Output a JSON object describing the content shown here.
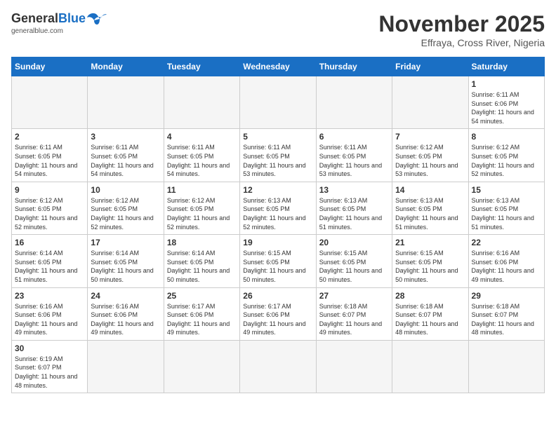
{
  "header": {
    "logo": {
      "general": "General",
      "blue": "Blue",
      "tagline": "generalblue.com"
    },
    "title": "November 2025",
    "subtitle": "Effraya, Cross River, Nigeria"
  },
  "weekdays": [
    "Sunday",
    "Monday",
    "Tuesday",
    "Wednesday",
    "Thursday",
    "Friday",
    "Saturday"
  ],
  "weeks": [
    [
      {
        "day": "",
        "info": ""
      },
      {
        "day": "",
        "info": ""
      },
      {
        "day": "",
        "info": ""
      },
      {
        "day": "",
        "info": ""
      },
      {
        "day": "",
        "info": ""
      },
      {
        "day": "",
        "info": ""
      },
      {
        "day": "1",
        "info": "Sunrise: 6:11 AM\nSunset: 6:06 PM\nDaylight: 11 hours\nand 54 minutes."
      }
    ],
    [
      {
        "day": "2",
        "info": "Sunrise: 6:11 AM\nSunset: 6:05 PM\nDaylight: 11 hours\nand 54 minutes."
      },
      {
        "day": "3",
        "info": "Sunrise: 6:11 AM\nSunset: 6:05 PM\nDaylight: 11 hours\nand 54 minutes."
      },
      {
        "day": "4",
        "info": "Sunrise: 6:11 AM\nSunset: 6:05 PM\nDaylight: 11 hours\nand 54 minutes."
      },
      {
        "day": "5",
        "info": "Sunrise: 6:11 AM\nSunset: 6:05 PM\nDaylight: 11 hours\nand 53 minutes."
      },
      {
        "day": "6",
        "info": "Sunrise: 6:11 AM\nSunset: 6:05 PM\nDaylight: 11 hours\nand 53 minutes."
      },
      {
        "day": "7",
        "info": "Sunrise: 6:12 AM\nSunset: 6:05 PM\nDaylight: 11 hours\nand 53 minutes."
      },
      {
        "day": "8",
        "info": "Sunrise: 6:12 AM\nSunset: 6:05 PM\nDaylight: 11 hours\nand 52 minutes."
      }
    ],
    [
      {
        "day": "9",
        "info": "Sunrise: 6:12 AM\nSunset: 6:05 PM\nDaylight: 11 hours\nand 52 minutes."
      },
      {
        "day": "10",
        "info": "Sunrise: 6:12 AM\nSunset: 6:05 PM\nDaylight: 11 hours\nand 52 minutes."
      },
      {
        "day": "11",
        "info": "Sunrise: 6:12 AM\nSunset: 6:05 PM\nDaylight: 11 hours\nand 52 minutes."
      },
      {
        "day": "12",
        "info": "Sunrise: 6:13 AM\nSunset: 6:05 PM\nDaylight: 11 hours\nand 52 minutes."
      },
      {
        "day": "13",
        "info": "Sunrise: 6:13 AM\nSunset: 6:05 PM\nDaylight: 11 hours\nand 51 minutes."
      },
      {
        "day": "14",
        "info": "Sunrise: 6:13 AM\nSunset: 6:05 PM\nDaylight: 11 hours\nand 51 minutes."
      },
      {
        "day": "15",
        "info": "Sunrise: 6:13 AM\nSunset: 6:05 PM\nDaylight: 11 hours\nand 51 minutes."
      }
    ],
    [
      {
        "day": "16",
        "info": "Sunrise: 6:14 AM\nSunset: 6:05 PM\nDaylight: 11 hours\nand 51 minutes."
      },
      {
        "day": "17",
        "info": "Sunrise: 6:14 AM\nSunset: 6:05 PM\nDaylight: 11 hours\nand 50 minutes."
      },
      {
        "day": "18",
        "info": "Sunrise: 6:14 AM\nSunset: 6:05 PM\nDaylight: 11 hours\nand 50 minutes."
      },
      {
        "day": "19",
        "info": "Sunrise: 6:15 AM\nSunset: 6:05 PM\nDaylight: 11 hours\nand 50 minutes."
      },
      {
        "day": "20",
        "info": "Sunrise: 6:15 AM\nSunset: 6:05 PM\nDaylight: 11 hours\nand 50 minutes."
      },
      {
        "day": "21",
        "info": "Sunrise: 6:15 AM\nSunset: 6:05 PM\nDaylight: 11 hours\nand 50 minutes."
      },
      {
        "day": "22",
        "info": "Sunrise: 6:16 AM\nSunset: 6:06 PM\nDaylight: 11 hours\nand 49 minutes."
      }
    ],
    [
      {
        "day": "23",
        "info": "Sunrise: 6:16 AM\nSunset: 6:06 PM\nDaylight: 11 hours\nand 49 minutes."
      },
      {
        "day": "24",
        "info": "Sunrise: 6:16 AM\nSunset: 6:06 PM\nDaylight: 11 hours\nand 49 minutes."
      },
      {
        "day": "25",
        "info": "Sunrise: 6:17 AM\nSunset: 6:06 PM\nDaylight: 11 hours\nand 49 minutes."
      },
      {
        "day": "26",
        "info": "Sunrise: 6:17 AM\nSunset: 6:06 PM\nDaylight: 11 hours\nand 49 minutes."
      },
      {
        "day": "27",
        "info": "Sunrise: 6:18 AM\nSunset: 6:07 PM\nDaylight: 11 hours\nand 49 minutes."
      },
      {
        "day": "28",
        "info": "Sunrise: 6:18 AM\nSunset: 6:07 PM\nDaylight: 11 hours\nand 48 minutes."
      },
      {
        "day": "29",
        "info": "Sunrise: 6:18 AM\nSunset: 6:07 PM\nDaylight: 11 hours\nand 48 minutes."
      }
    ],
    [
      {
        "day": "30",
        "info": "Sunrise: 6:19 AM\nSunset: 6:07 PM\nDaylight: 11 hours\nand 48 minutes."
      },
      {
        "day": "",
        "info": ""
      },
      {
        "day": "",
        "info": ""
      },
      {
        "day": "",
        "info": ""
      },
      {
        "day": "",
        "info": ""
      },
      {
        "day": "",
        "info": ""
      },
      {
        "day": "",
        "info": ""
      }
    ]
  ]
}
